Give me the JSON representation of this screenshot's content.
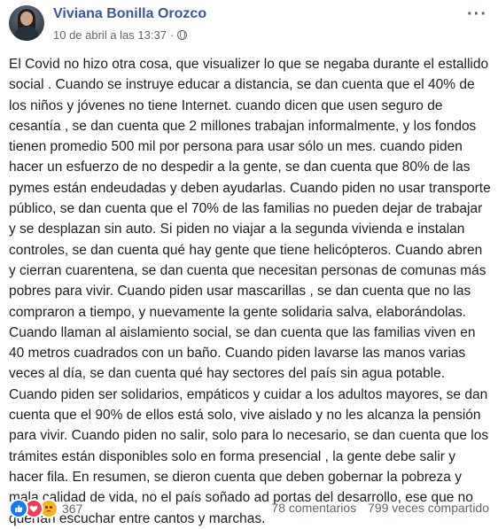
{
  "post": {
    "author": "Viviana Bonilla Orozco",
    "timestamp": "10 de abril a las 13:37",
    "separator": "·",
    "privacy_icon": "globe-icon",
    "more_icon": "more-options-icon",
    "body": "El Covid no hizo otra cosa, que visualizer lo que se negaba durante el estallido social . Cuando se instruye educar a distancia, se dan cuenta que el 40% de los niños y jóvenes no tiene Internet. cuando dicen que usen seguro de cesantía , se dan cuenta que 2 millones trabajan informalmente, y los fondos tienen promedio 500 mil por persona para usar sólo un mes. cuando piden hacer un esfuerzo de no despedir a la gente, se dan cuenta que 80% de las pymes están endeudadas y deben ayudarlas. Cuando piden no usar transporte público, se dan cuenta que el 70% de las familias no pueden dejar de trabajar y se desplazan sin auto. Si piden no viajar a la segunda vivienda e instalan controles, se dan cuenta qué hay gente que tiene helicópteros. Cuando abren y cierran cuarentena, se dan cuenta que necesitan personas de comunas más pobres para vivir. Cuando piden usar mascarillas , se dan cuenta que no las compraron a tiempo, y nuevamente la gente solidaria salva, elaborándolas. Cuando llaman al aislamiento social, se dan cuenta que las familias viven en 40 metros cuadrados con un baño. Cuando piden lavarse las manos varias veces al día, se dan cuenta qué hay sectores del país sin agua potable. Cuando piden ser solidarios, empáticos y cuidar a los adultos mayores, se dan cuenta que el 90% de ellos está solo, vive aislado y no les alcanza la pensión para vivir. Cuando piden no salir, solo para lo necesario, se dan cuenta que los trámites están disponibles solo en forma presencial , la gente debe salir y hacer fila. En resumen, se dieron cuenta que deben gobernar la pobreza y mala calidad de vida, no el país soñado ad portas del desarrollo, ese que no querían escuchar entre cantos y marchas."
  },
  "footer": {
    "reactions": [
      "like-icon",
      "love-icon",
      "sad-icon"
    ],
    "reaction_count": "367",
    "comments": "78 comentarios",
    "shares": "799 veces compartido"
  },
  "colors": {
    "author_link": "#385898",
    "meta_text": "#606770",
    "body_text": "#1c1e21",
    "like": "#1877f2",
    "love": "#f33e58",
    "sad": "#f7b125"
  }
}
